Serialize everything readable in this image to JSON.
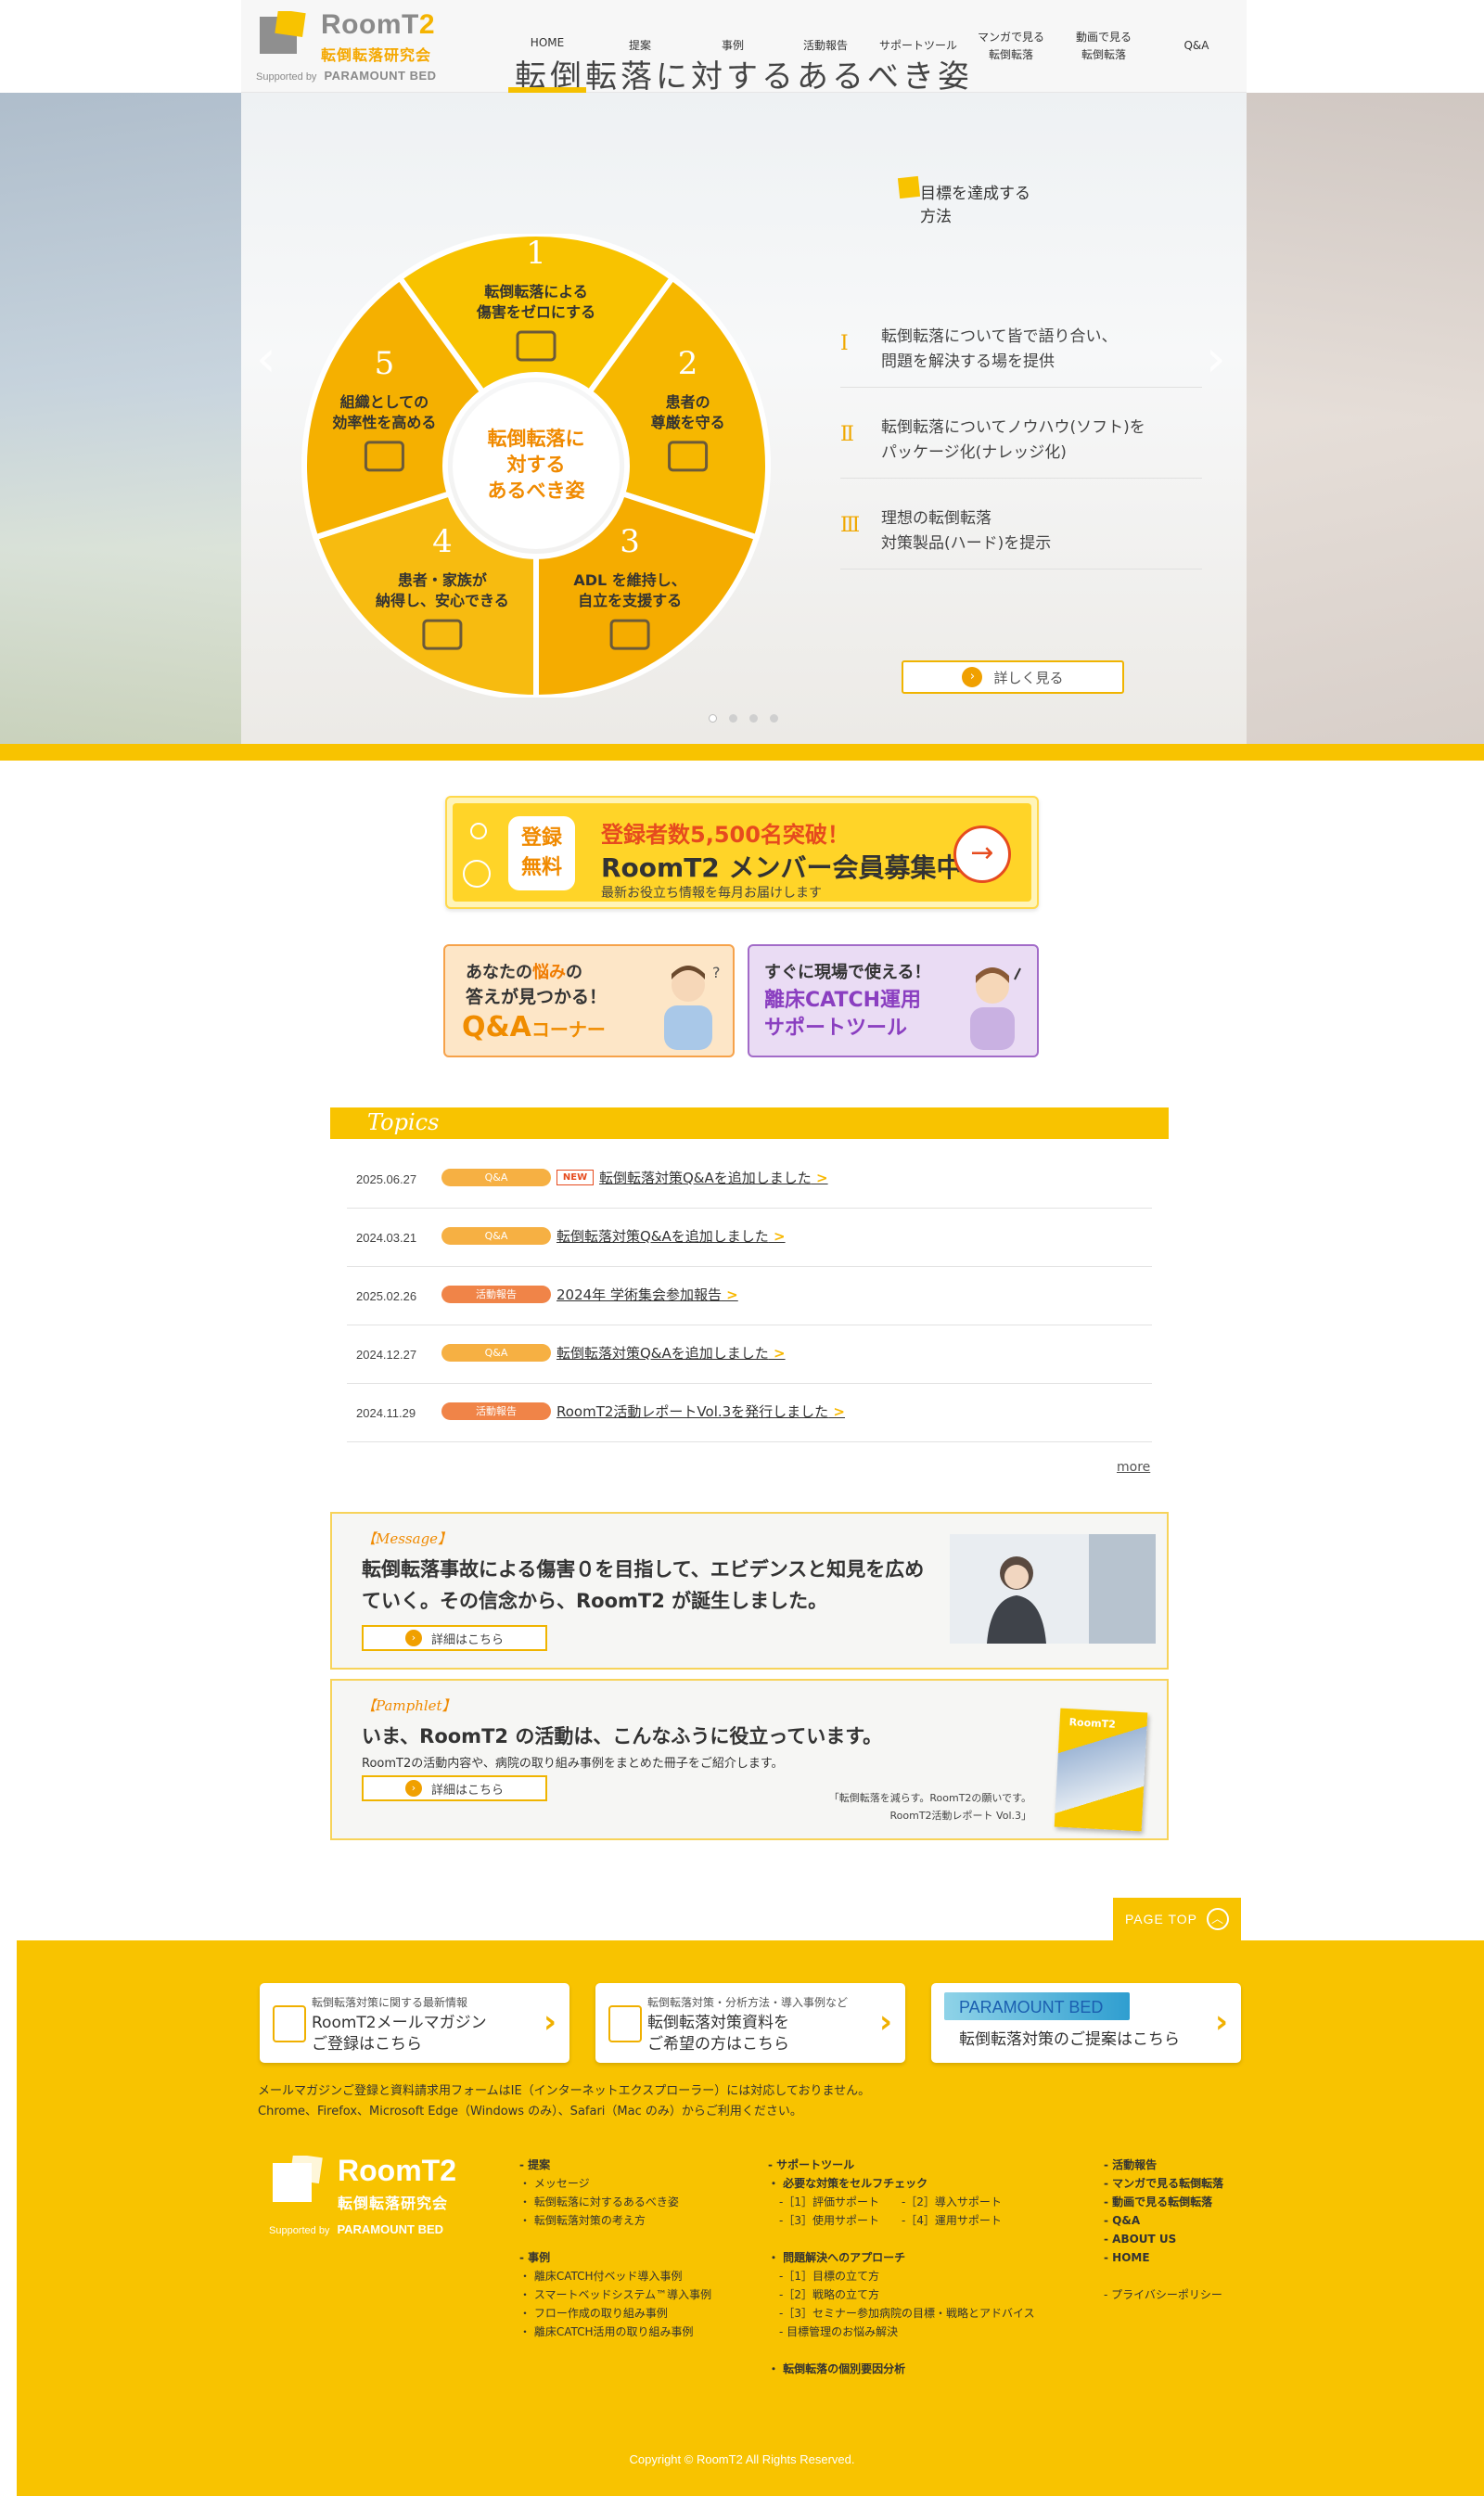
{
  "header": {
    "logo": {
      "title_main": "RoomT",
      "title_suffix": "2",
      "subtitle": "転倒転落研究会",
      "supported_by": "Supported by",
      "company": "PARAMOUNT BED"
    },
    "nav": [
      "HOME",
      "提案",
      "事例",
      "活動報告",
      "サポートツール",
      "マンガで見る\n転倒転落",
      "動画で見る\n転倒転落",
      "Q&A"
    ]
  },
  "hero": {
    "title": "転倒転落に対するあるべき姿",
    "wheel": {
      "center": [
        "転倒転落に",
        "対する",
        "あるべき姿"
      ],
      "segments": [
        {
          "num": "1",
          "lines": [
            "転倒転落による",
            "傷害をゼロにする"
          ]
        },
        {
          "num": "2",
          "lines": [
            "患者の",
            "尊厳を守る"
          ]
        },
        {
          "num": "3",
          "lines": [
            "ADL を維持し、",
            "自立を支援する"
          ]
        },
        {
          "num": "4",
          "lines": [
            "患者・家族が",
            "納得し、安心できる"
          ]
        },
        {
          "num": "5",
          "lines": [
            "組織としての",
            "効率性を高める"
          ]
        }
      ]
    },
    "goals_title": "目標を達成する方法",
    "goals": [
      {
        "num": "Ⅰ",
        "line1": "転倒転落について皆で語り合い、",
        "line2": "問題を解決する場を提供"
      },
      {
        "num": "Ⅱ",
        "line1": "転倒転落についてノウハウ(ソフト)を",
        "line2": "パッケージ化(ナレッジ化)"
      },
      {
        "num": "Ⅲ",
        "line1": "理想の転倒転落",
        "line2": "対策製品(ハード)を提示"
      }
    ],
    "more_label": "詳しく見る",
    "prev": "‹",
    "next": "›"
  },
  "member": {
    "free_1": "登録",
    "free_2": "無料",
    "line1": "登録者数5,500名突破！",
    "line2": "RoomT2 メンバー会員募集中",
    "line3": "最新お役立ち情報を毎月お届けします",
    "arrow": "→"
  },
  "qa_card": {
    "line1_a": "あなたの",
    "line1_b": "悩み",
    "line1_c": "の",
    "line2": "答えが見つかる！",
    "big": "Q&A",
    "big_suffix": "コーナー"
  },
  "catch_card": {
    "line1": "すぐに現場で使える！",
    "line2": "離床CATCH運用",
    "line3": "サポートツール"
  },
  "topics": {
    "heading": "Topics",
    "items": [
      {
        "date": "2025.06.27",
        "cat": "Q&A",
        "cat_type": "qa",
        "new": "NEW",
        "title": "転倒転落対策Q&Aを追加しました"
      },
      {
        "date": "2024.03.21",
        "cat": "Q&A",
        "cat_type": "qa",
        "new": "",
        "title": "転倒転落対策Q&Aを追加しました"
      },
      {
        "date": "2025.02.26",
        "cat": "活動報告",
        "cat_type": "rep",
        "new": "",
        "title": "2024年 学術集会参加報告"
      },
      {
        "date": "2024.12.27",
        "cat": "Q&A",
        "cat_type": "qa",
        "new": "",
        "title": "転倒転落対策Q&Aを追加しました"
      },
      {
        "date": "2024.11.29",
        "cat": "活動報告",
        "cat_type": "rep",
        "new": "",
        "title": "RoomT2活動レポートVol.3を発行しました"
      }
    ],
    "more": "more"
  },
  "message": {
    "tag": "【Message】",
    "line1": "転倒転落事故による傷害０を目指して、エビデンスと知見を広め",
    "line2": "ていく。その信念から、RoomT2 が誕生しました。",
    "button": "詳細はこちら"
  },
  "pamphlet": {
    "tag": "【Pamphlet】",
    "heading": "いま、RoomT2 の活動は、こんなふうに役立っています。",
    "desc": "RoomT2の活動内容や、病院の取り組み事例をまとめた冊子をご紹介します。",
    "button": "詳細はこちら",
    "booklet_title": "RoomT2",
    "caption1": "「転倒転落を減らす。RoomT2の願いです。",
    "caption2": "RoomT2活動レポート Vol.3」"
  },
  "page_top": "PAGE TOP",
  "footer": {
    "buttons": [
      {
        "small": "転倒転落対策に関する最新情報",
        "big1": "RoomT2メールマガジン",
        "big2": "ご登録はこちら",
        "chev": "›"
      },
      {
        "small": "転倒転落対策・分析方法・導入事例など",
        "big1": "転倒転落対策資料を",
        "big2": "ご希望の方はこちら",
        "chev": "›"
      },
      {
        "brand": "PARAMOUNT BED",
        "big1": "転倒転落対策のご提案はこちら",
        "chev": "›"
      }
    ],
    "note1": "メールマガジンご登録と資料請求用フォームはIE（インターネットエクスプローラー）には対応しておりません。",
    "note2": "Chrome、Firefox、Microsoft Edge（Windows のみ）、Safari（Mac のみ）からご利用ください。",
    "logo": {
      "title": "RoomT2",
      "subtitle": "転倒転落研究会",
      "supported_by": "Supported by",
      "company": "PARAMOUNT BED"
    },
    "col1": [
      {
        "t": "- 提案",
        "h": true
      },
      {
        "t": "・ メッセージ",
        "h": false
      },
      {
        "t": "・ 転倒転落に対するあるべき姿",
        "h": false
      },
      {
        "t": "・ 転倒転落対策の考え方",
        "h": false
      },
      {
        "t": "",
        "h": false
      },
      {
        "t": "- 事例",
        "h": true
      },
      {
        "t": "・ 離床CATCH付ベッド導入事例",
        "h": false
      },
      {
        "t": "・ スマートベッドシステム™導入事例",
        "h": false
      },
      {
        "t": "・ フロー作成の取り組み事例",
        "h": false
      },
      {
        "t": "・ 離床CATCH活用の取り組み事例",
        "h": false
      }
    ],
    "col2": [
      {
        "t": "- サポートツール",
        "h": true
      },
      {
        "t": "・ 必要な対策をセルフチェック",
        "h": true
      },
      {
        "t": "　-［1］評価サポート　　-［2］導入サポート",
        "h": false
      },
      {
        "t": "　-［3］使用サポート　　-［4］運用サポート",
        "h": false
      },
      {
        "t": "",
        "h": false
      },
      {
        "t": "・ 問題解決へのアプローチ",
        "h": true
      },
      {
        "t": "　-［1］目標の立て方",
        "h": false
      },
      {
        "t": "　-［2］戦略の立て方",
        "h": false
      },
      {
        "t": "　-［3］セミナー参加病院の目標・戦略とアドバイス",
        "h": false
      },
      {
        "t": "　- 目標管理のお悩み解決",
        "h": false
      },
      {
        "t": "",
        "h": false
      },
      {
        "t": "・ 転倒転落の個別要因分析",
        "h": true
      }
    ],
    "col3": [
      {
        "t": "- 活動報告",
        "h": true
      },
      {
        "t": "- マンガで見る転倒転落",
        "h": true
      },
      {
        "t": "- 動画で見る転倒転落",
        "h": true
      },
      {
        "t": "- Q&A",
        "h": true
      },
      {
        "t": "- ABOUT US",
        "h": true
      },
      {
        "t": "- HOME",
        "h": true
      },
      {
        "t": "",
        "h": false
      },
      {
        "t": "- プライバシーポリシー",
        "h": false
      }
    ],
    "copyright": "Copyright © RoomT2 All Rights Reserved."
  },
  "colors": {
    "brand_yellow": "#f8c300",
    "wheel_orange": "#f5a800",
    "accent_red": "#e64b1e",
    "qa_purple": "#8a3ec0"
  }
}
